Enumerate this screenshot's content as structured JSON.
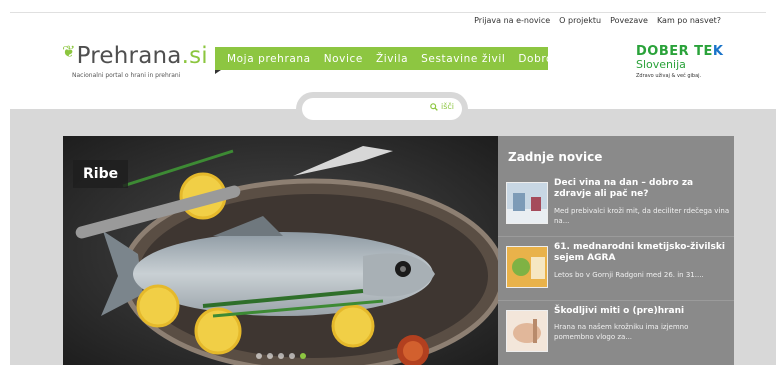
{
  "top_links": [
    "Prijava na e-novice",
    "O projektu",
    "Povezave",
    "Kam po nasvet?"
  ],
  "logo": {
    "name_prefix": "Prehrana",
    "name_suffix": ".si",
    "tagline": "Nacionalni portal o hrani in prehrani"
  },
  "nav": [
    "Moja prehrana",
    "Novice",
    "Živila",
    "Sestavine živil",
    "Dobro je vedeti"
  ],
  "partner": {
    "line1": "DOBER TE",
    "line1_k": "K",
    "line2": "Slovenija",
    "tagline": "Zdravo uživaj & več gibaj."
  },
  "search": {
    "placeholder": "",
    "button": "išči"
  },
  "hero": {
    "label": "Ribe",
    "slides": 5,
    "active_slide": 5
  },
  "news": {
    "heading": "Zadnje novice",
    "items": [
      {
        "title": "Deci vina na dan – dobro za zdravje ali pač ne?",
        "desc": "Med prebivalci kroži mit, da deciliter rdečega vina na..."
      },
      {
        "title": "61. mednarodni kmetijsko-živilski sejem AGRA",
        "desc": "Letos bo v Gornji Radgoni med 26. in 31...."
      },
      {
        "title": "Škodljivi miti o (pre)hrani",
        "desc": "Hrana na našem krožniku ima izjemno pomembno vlogo za..."
      }
    ]
  },
  "colors": {
    "accent_green": "#8dc641",
    "news_bg": "#8a8a8a",
    "band_bg": "#d8d8d8"
  }
}
